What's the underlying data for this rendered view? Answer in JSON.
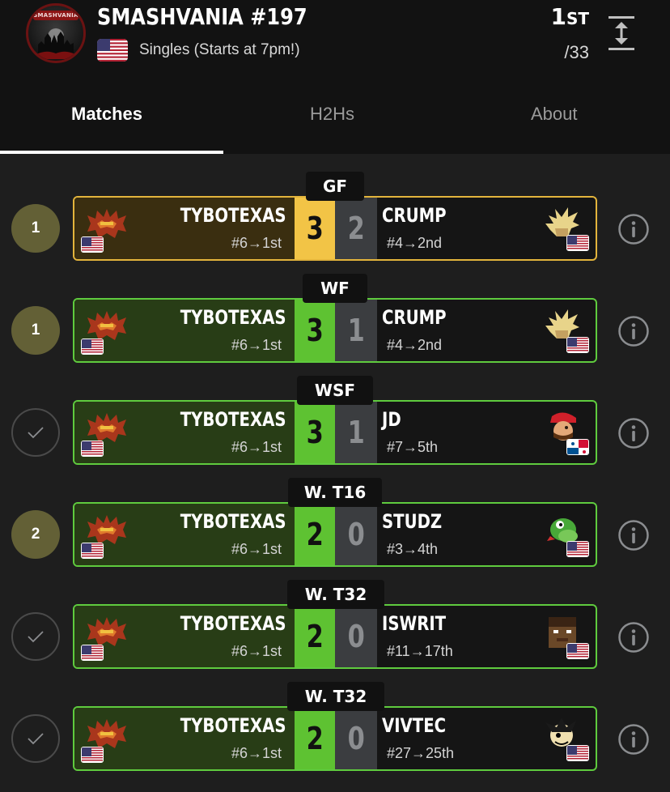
{
  "header": {
    "logo_text": "SMASHVANIA",
    "title": "SMASHVANIA #197",
    "event": "Singles (Starts at 7pm!)",
    "placing": "1",
    "placing_suffix": "ST",
    "entrants": "/33"
  },
  "tabs": [
    {
      "label": "Matches",
      "active": true
    },
    {
      "label": "H2Hs",
      "active": false
    },
    {
      "label": "About",
      "active": false
    }
  ],
  "matches": [
    {
      "round": "GF",
      "status": "1",
      "style": "gf",
      "p1": {
        "name": "TYBOTEXAS",
        "seed": "#6→1st",
        "score": "3",
        "flag": "us"
      },
      "p2": {
        "name": "CRUMP",
        "seed": "#4→2nd",
        "score": "2",
        "flag": "us",
        "character": "cloud"
      }
    },
    {
      "round": "WF",
      "status": "1",
      "style": "win",
      "p1": {
        "name": "TYBOTEXAS",
        "seed": "#6→1st",
        "score": "3",
        "flag": "us"
      },
      "p2": {
        "name": "CRUMP",
        "seed": "#4→2nd",
        "score": "1",
        "flag": "us",
        "character": "cloud"
      }
    },
    {
      "round": "WSF",
      "status": "check",
      "style": "win",
      "p1": {
        "name": "TYBOTEXAS",
        "seed": "#6→1st",
        "score": "3",
        "flag": "us"
      },
      "p2": {
        "name": "JD",
        "seed": "#7→5th",
        "score": "1",
        "flag": "pa",
        "character": "mario"
      }
    },
    {
      "round": "W. T16",
      "status": "2",
      "style": "win",
      "p1": {
        "name": "TYBOTEXAS",
        "seed": "#6→1st",
        "score": "2",
        "flag": "us"
      },
      "p2": {
        "name": "STUDZ",
        "seed": "#3→4th",
        "score": "0",
        "flag": "us",
        "character": "yoshi"
      }
    },
    {
      "round": "W. T32",
      "status": "check",
      "style": "win",
      "p1": {
        "name": "TYBOTEXAS",
        "seed": "#6→1st",
        "score": "2",
        "flag": "us"
      },
      "p2": {
        "name": "ISWRIT",
        "seed": "#11→17th",
        "score": "0",
        "flag": "us",
        "character": "steve"
      }
    },
    {
      "round": "W. T32",
      "status": "check",
      "style": "win",
      "p1": {
        "name": "TYBOTEXAS",
        "seed": "#6→1st",
        "score": "2",
        "flag": "us"
      },
      "p2": {
        "name": "VIVTEC",
        "seed": "#27→25th",
        "score": "0",
        "flag": "us",
        "character": "banjo"
      }
    }
  ],
  "colors": {
    "win_green": "#5ec232",
    "gf_gold": "#f2c446",
    "loss_gray": "#3b3d40",
    "status_olive": "#636036"
  }
}
